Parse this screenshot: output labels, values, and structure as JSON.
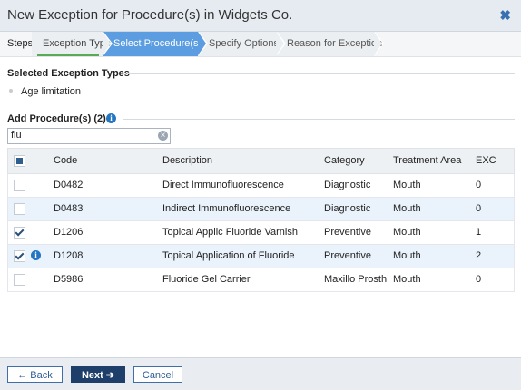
{
  "window": {
    "title": "New Exception for Procedure(s) in Widgets Co."
  },
  "wizard": {
    "steps_label": "Steps",
    "steps": [
      {
        "label": "Exception Type",
        "state": "completed"
      },
      {
        "label": "Select Procedure(s)",
        "state": "active"
      },
      {
        "label": "Specify Options",
        "state": "pending"
      },
      {
        "label": "Reason for Exception",
        "state": "pending"
      }
    ]
  },
  "selected_types": {
    "heading": "Selected Exception Types",
    "items": [
      "Age limitation"
    ]
  },
  "add_procedures": {
    "heading": "Add Procedure(s) (2)",
    "search_value": "flu"
  },
  "grid": {
    "headers": {
      "code": "Code",
      "description": "Description",
      "category": "Category",
      "area": "Treatment Area",
      "exc": "EXC"
    },
    "rows": [
      {
        "code": "D0482",
        "description": "Direct Immunofluorescence",
        "category": "Diagnostic",
        "area": "Mouth",
        "exc": "0",
        "checked": false
      },
      {
        "code": "D0483",
        "description": "Indirect Immunofluorescence",
        "category": "Diagnostic",
        "area": "Mouth",
        "exc": "0",
        "checked": false
      },
      {
        "code": "D1206",
        "description": "Topical Applic Fluoride Varnish",
        "category": "Preventive",
        "area": "Mouth",
        "exc": "1",
        "checked": true
      },
      {
        "code": "D1208",
        "description": "Topical Application of Fluoride",
        "category": "Preventive",
        "area": "Mouth",
        "exc": "2",
        "checked": true
      },
      {
        "code": "D5986",
        "description": "Fluoride Gel Carrier",
        "category": "Maxillo Prosth",
        "area": "Mouth",
        "exc": "0",
        "checked": false
      }
    ]
  },
  "footer": {
    "back_label": "← Back",
    "next_label": "Next ➔",
    "cancel_label": "Cancel"
  },
  "colors": {
    "active_step": "#5b9de0",
    "completed_bar": "#5aaa55",
    "primary_button": "#1f3f6b",
    "info_icon": "#2475c2"
  }
}
